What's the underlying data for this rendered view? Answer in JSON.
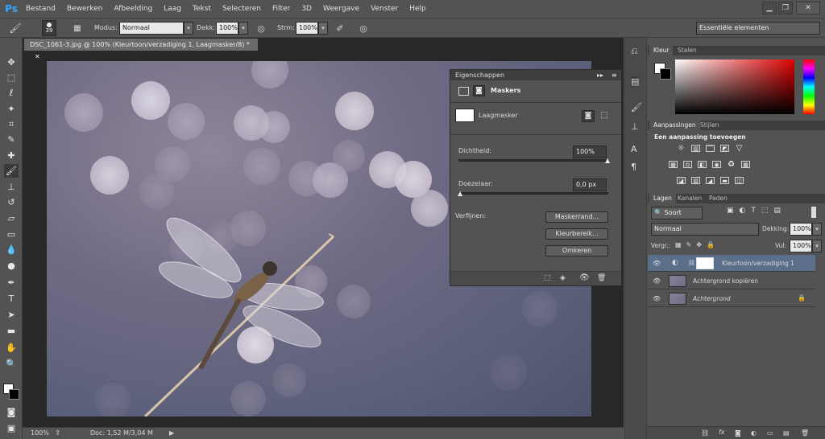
{
  "app": {
    "logo": "Ps"
  },
  "menu": [
    "Bestand",
    "Bewerken",
    "Afbeelding",
    "Laag",
    "Tekst",
    "Selecteren",
    "Filter",
    "3D",
    "Weergave",
    "Venster",
    "Help"
  ],
  "window_controls": {
    "minimize": "▁",
    "restore": "❐",
    "close": "✕"
  },
  "options_bar": {
    "brush_size": "39",
    "mode_label": "Modus:",
    "mode_value": "Normaal",
    "opacity_label": "Dekk:",
    "opacity_value": "100%",
    "flow_label": "Strm:",
    "flow_value": "100%",
    "workspace": "Essentiële elementen"
  },
  "document": {
    "tab_title": "DSC_1061-3.jpg @ 100% (Kleurtoon/verzadiging 1, Laagmasker/8) *",
    "zoom": "100%",
    "doc_info": "Doc: 1,52 M/3,04 M"
  },
  "properties": {
    "title": "Eigenschappen",
    "section": "Maskers",
    "mask_label": "Laagmasker",
    "density_label": "Dichtheid:",
    "density_value": "100%",
    "density_fraction": 1.0,
    "feather_label": "Doezelaar:",
    "feather_value": "0,0 px",
    "feather_fraction": 0.0,
    "refine_label": "Verfijnen:",
    "btn_mask_edge": "Maskerrand...",
    "btn_color_range": "Kleurbereik...",
    "btn_invert": "Omkeren"
  },
  "color_panel": {
    "tabs": [
      "Kleur",
      "Stalen"
    ]
  },
  "adjustments_panel": {
    "tabs": [
      "Aanpassingen",
      "Stijlen"
    ],
    "heading": "Een aanpassing toevoegen"
  },
  "layers_panel": {
    "tabs": [
      "Lagen",
      "Kanalen",
      "Paden"
    ],
    "filter_label": "Soort",
    "blend_mode": "Normaal",
    "opacity_label": "Dekking:",
    "opacity_value": "100%",
    "lock_label": "Vergr.:",
    "fill_label": "Vul:",
    "fill_value": "100%",
    "layers": [
      {
        "name": "Kleurtoon/verzadiging 1",
        "selected": true
      },
      {
        "name": "Achtergrond kopiëren",
        "selected": false
      },
      {
        "name": "Achtergrond",
        "selected": false,
        "locked": true
      }
    ]
  },
  "colors": {
    "accent": "#31a8ff",
    "selected_layer": "#5b6f8a",
    "panel": "#535353"
  }
}
